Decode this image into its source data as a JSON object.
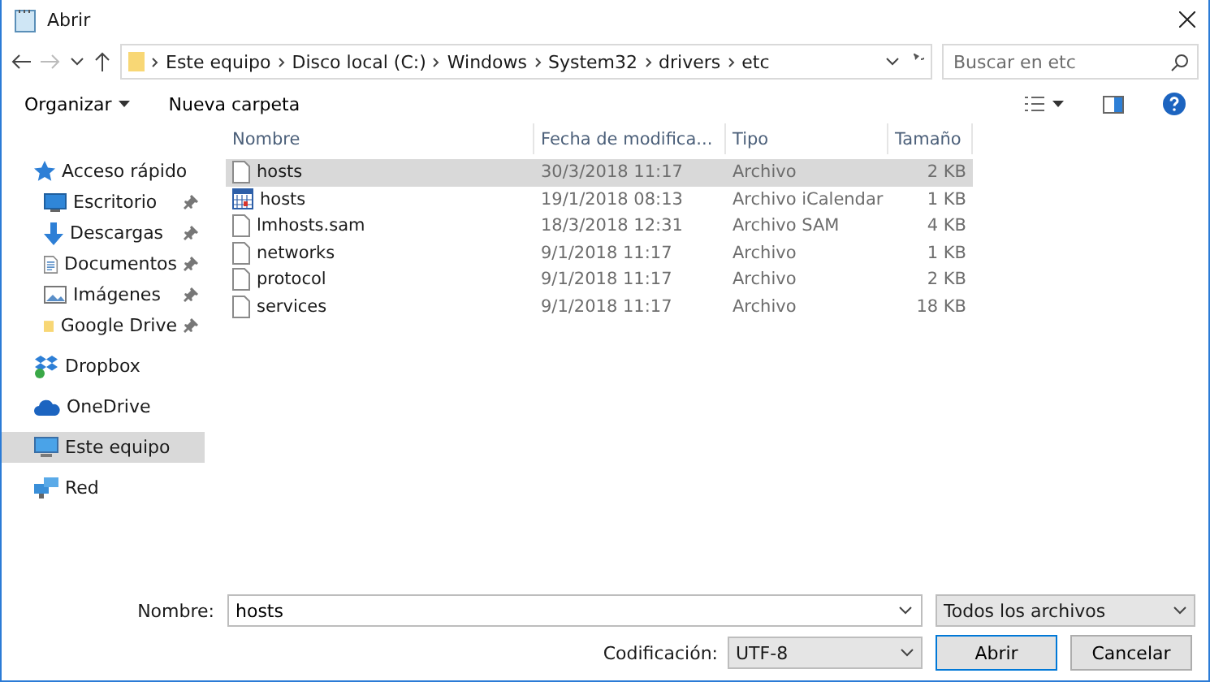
{
  "window": {
    "title": "Abrir"
  },
  "breadcrumb": [
    "Este equipo",
    "Disco local (C:)",
    "Windows",
    "System32",
    "drivers",
    "etc"
  ],
  "search": {
    "placeholder": "Buscar en etc"
  },
  "toolbar": {
    "organize": "Organizar",
    "new_folder": "Nueva carpeta"
  },
  "sidebar": {
    "items": [
      {
        "label": "Acceso rápido",
        "kind": "star",
        "pinned": false,
        "selected": false,
        "children": [
          {
            "label": "Escritorio",
            "kind": "desktop",
            "pinned": true,
            "selected": false
          },
          {
            "label": "Descargas",
            "kind": "download",
            "pinned": true,
            "selected": false
          },
          {
            "label": "Documentos",
            "kind": "documents",
            "pinned": true,
            "selected": false
          },
          {
            "label": "Imágenes",
            "kind": "pictures",
            "pinned": true,
            "selected": false
          },
          {
            "label": "Google Drive",
            "kind": "folder",
            "pinned": true,
            "selected": false
          }
        ]
      },
      {
        "label": "Dropbox",
        "kind": "dropbox",
        "pinned": false,
        "selected": false
      },
      {
        "label": "OneDrive",
        "kind": "onedrive",
        "pinned": false,
        "selected": false
      },
      {
        "label": "Este equipo",
        "kind": "computer",
        "pinned": false,
        "selected": true
      },
      {
        "label": "Red",
        "kind": "network",
        "pinned": false,
        "selected": false
      }
    ]
  },
  "table": {
    "columns": [
      "Nombre",
      "Fecha de modifica...",
      "Tipo",
      "Tamaño"
    ],
    "rows": [
      {
        "name": "hosts",
        "date": "30/3/2018 11:17",
        "type": "Archivo",
        "size": "2 KB",
        "kind": "file",
        "selected": true
      },
      {
        "name": "hosts",
        "date": "19/1/2018 08:13",
        "type": "Archivo iCalendar",
        "size": "1 KB",
        "kind": "calendar",
        "selected": false
      },
      {
        "name": "lmhosts.sam",
        "date": "18/3/2018 12:31",
        "type": "Archivo SAM",
        "size": "4 KB",
        "kind": "file",
        "selected": false
      },
      {
        "name": "networks",
        "date": "9/1/2018 11:17",
        "type": "Archivo",
        "size": "1 KB",
        "kind": "file",
        "selected": false
      },
      {
        "name": "protocol",
        "date": "9/1/2018 11:17",
        "type": "Archivo",
        "size": "2 KB",
        "kind": "file",
        "selected": false
      },
      {
        "name": "services",
        "date": "9/1/2018 11:17",
        "type": "Archivo",
        "size": "18 KB",
        "kind": "file",
        "selected": false
      }
    ]
  },
  "footer": {
    "name_label": "Nombre:",
    "name_value": "hosts",
    "filter": "Todos los archivos",
    "encoding_label": "Codificación:",
    "encoding": "UTF-8",
    "open": "Abrir",
    "cancel": "Cancelar"
  }
}
